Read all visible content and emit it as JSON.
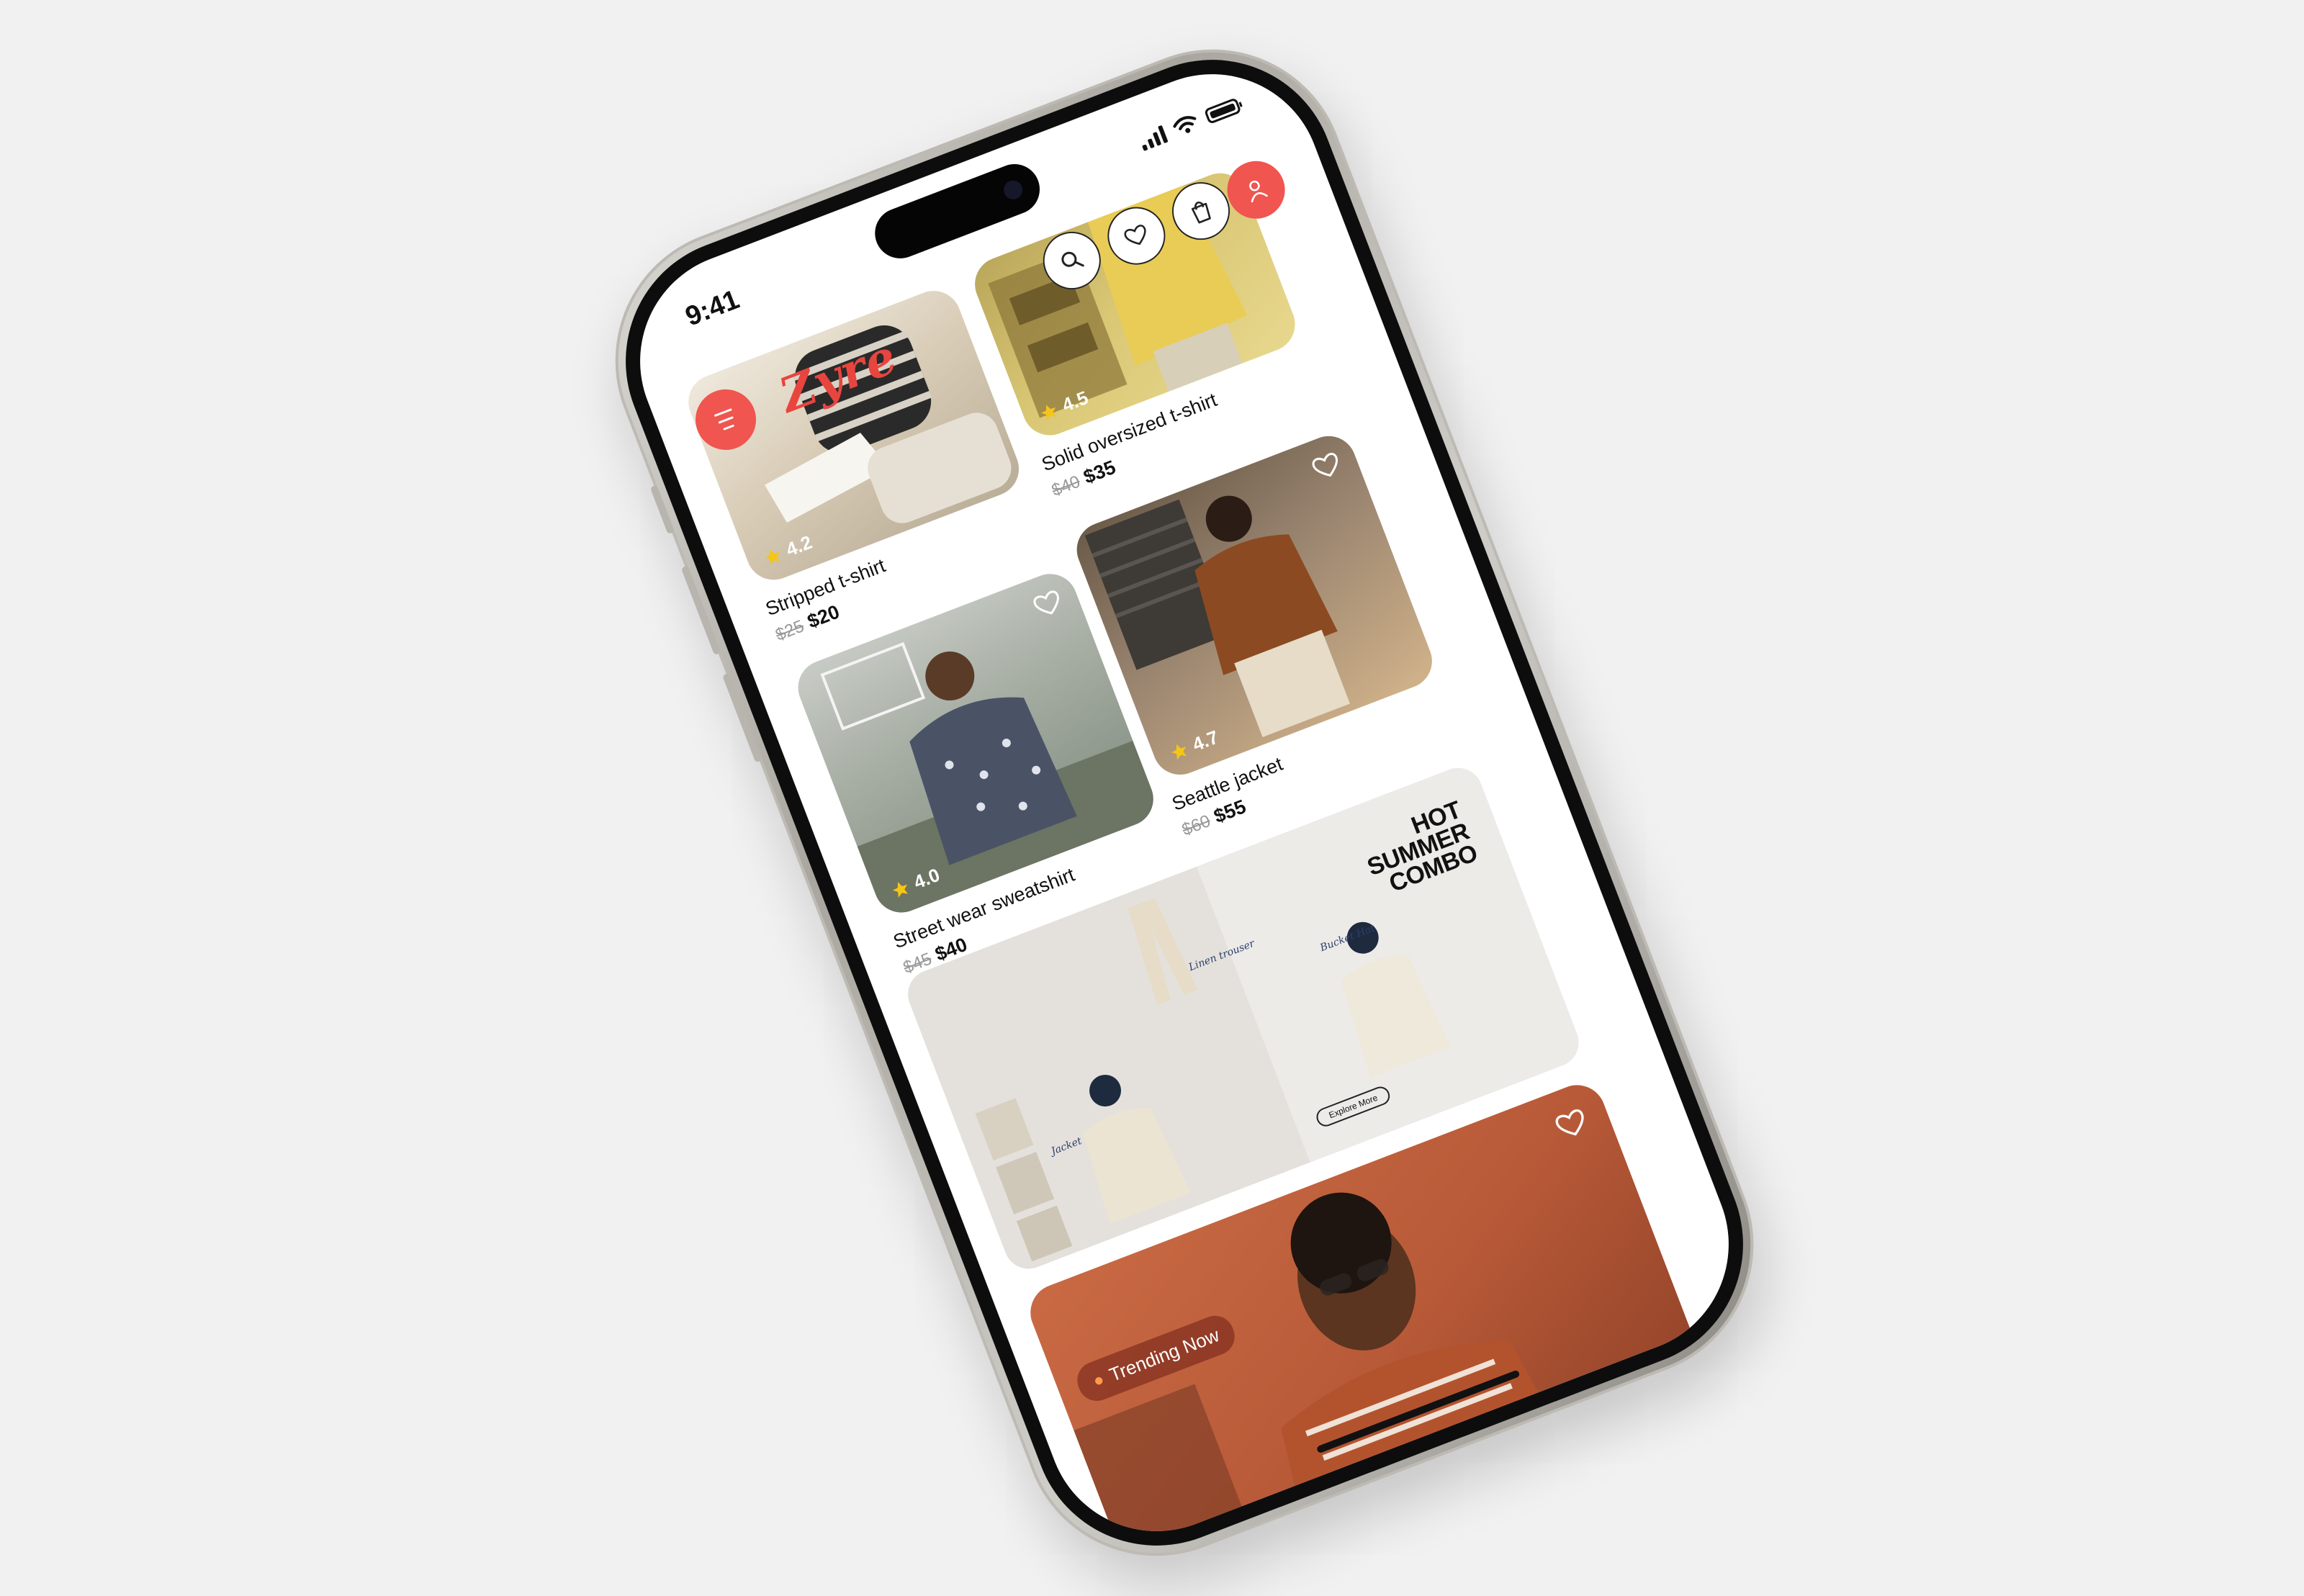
{
  "status_bar": {
    "time": "9:41"
  },
  "app": {
    "logo": "Zyre"
  },
  "icons": {
    "menu": "menu-icon",
    "search": "search-icon",
    "wishlist": "heart-icon",
    "cart": "shopping-bag-icon",
    "profile": "user-icon"
  },
  "colors": {
    "accent": "#f0554f",
    "logo": "#e8453f",
    "text": "#111111",
    "strike": "#999999",
    "star": "#f5c518"
  },
  "products": [
    {
      "name": "Stripped t-shirt",
      "rating": "4.2",
      "old_price": "$25",
      "price": "$20"
    },
    {
      "name": "Solid oversized t-shirt",
      "rating": "4.5",
      "old_price": "$40",
      "price": "$35"
    },
    {
      "name": "Street wear sweatshirt",
      "rating": "4.0",
      "old_price": "$45",
      "price": "$40"
    },
    {
      "name": "Seattle jacket",
      "rating": "4.7",
      "old_price": "$60",
      "price": "$55"
    }
  ],
  "banner": {
    "title_line1": "HOT",
    "title_line2": "SUMMER",
    "title_line3": "COMBO",
    "button": "Explore More",
    "annotations": {
      "trouser": "Linen trouser",
      "hat": "Bucket Hat",
      "jacket": "Jacket"
    }
  },
  "trending": {
    "badge": "Trending Now"
  }
}
